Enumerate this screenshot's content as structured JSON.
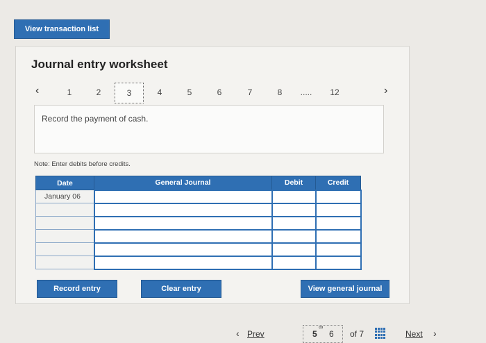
{
  "top_button": "View transaction list",
  "worksheet": {
    "title": "Journal entry worksheet",
    "pages": [
      "1",
      "2",
      "3",
      "4",
      "5",
      "6",
      "7",
      "8",
      ".....",
      "12"
    ],
    "active_page": "3",
    "prompt": "Record the payment of cash.",
    "note": "Note: Enter debits before credits.",
    "table": {
      "headers": [
        "Date",
        "General Journal",
        "Debit",
        "Credit"
      ],
      "rows": [
        {
          "date": "January 06"
        },
        {
          "date": ""
        },
        {
          "date": ""
        },
        {
          "date": ""
        },
        {
          "date": ""
        },
        {
          "date": ""
        }
      ]
    },
    "buttons": {
      "record": "Record entry",
      "clear": "Clear entry",
      "general_journal": "View general journal"
    }
  },
  "footer": {
    "prev": "Prev",
    "current": "5",
    "next_page": "6",
    "of": "of 7",
    "next": "Next"
  },
  "colors": {
    "accent": "#2f6fb3",
    "background": "#eceae6"
  }
}
